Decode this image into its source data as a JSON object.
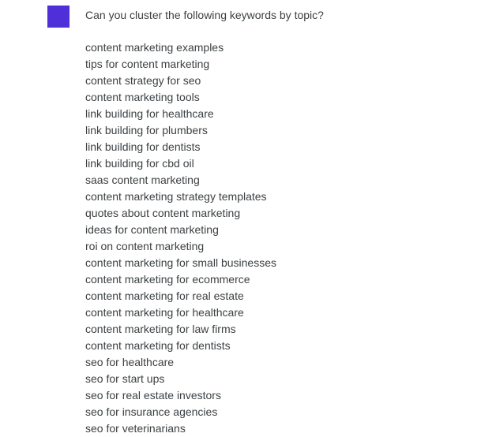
{
  "theme": {
    "background": "#ffffff",
    "text_color": "#3c4043",
    "avatar_color": "#4f2fd7"
  },
  "message": {
    "avatar_icon": "user-avatar-square",
    "prompt": "Can you cluster the following keywords by topic?",
    "keywords": [
      "content marketing examples",
      "tips for content marketing",
      "content strategy for seo",
      "content marketing tools",
      "link building for healthcare",
      "link building for plumbers",
      "link building for dentists",
      "link building for cbd oil",
      "saas content marketing",
      "content marketing strategy templates",
      "quotes about content marketing",
      "ideas for content marketing",
      "roi on content marketing",
      "content marketing for small businesses",
      "content marketing for ecommerce",
      "content marketing for real estate",
      "content marketing for healthcare",
      "content marketing for law firms",
      "content marketing for dentists",
      "seo for healthcare",
      "seo for start ups",
      "seo for real estate investors",
      "seo for insurance agencies",
      "seo for veterinarians"
    ]
  }
}
